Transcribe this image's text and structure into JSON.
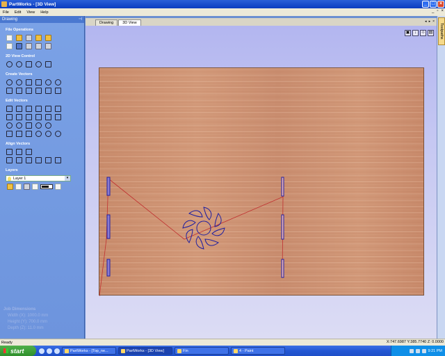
{
  "window": {
    "title": "PartWorks - [3D View]"
  },
  "menu": {
    "items": [
      "File",
      "Edit",
      "View",
      "Help"
    ]
  },
  "left_panel": {
    "header": "Drawing",
    "sections": {
      "file_operations": "File Operations",
      "view_control": "2D View Control",
      "create_vectors": "Create Vectors",
      "edit_vectors": "Edit Vectors",
      "align_vectors": "Align Vectors",
      "layers": "Layers"
    },
    "layer_select_value": "Layer 1"
  },
  "tabs": [
    "Drawing",
    "3D View"
  ],
  "active_tab": "3D View",
  "right_strip": {
    "label": "Toolpaths"
  },
  "job_dimensions": {
    "title": "Job Dimensions",
    "width": "Width  (X): 1000.0 mm",
    "height": "Height (Y): 700.0 mm",
    "depth": "Depth  (Z): 11.0 mm"
  },
  "status": {
    "left": "Ready",
    "coords": "X:747.6987 Y:385.7740 Z: 0.0000"
  },
  "taskbar": {
    "start_label": "start",
    "tasks": [
      {
        "label": "PartWorks - [Top_ne...",
        "active": false
      },
      {
        "label": "PartWorks - [3D View]",
        "active": true
      },
      {
        "label": "Fin",
        "active": false
      },
      {
        "label": "4 - Paint",
        "active": false
      }
    ],
    "clock": "9:21 PM"
  },
  "colors": {
    "board_wood": "#cc9173",
    "vector_blue": "#2020a0",
    "toolpath_red": "#c03030"
  }
}
